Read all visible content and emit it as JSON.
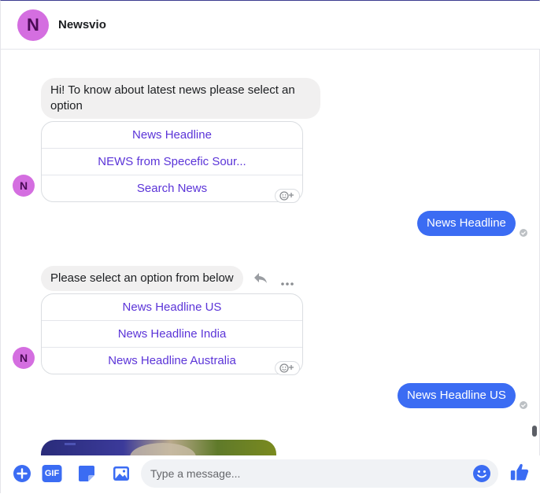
{
  "header": {
    "avatar_letter": "N",
    "title": "Newsvio"
  },
  "messages": {
    "greeting": {
      "text": "Hi! To know about latest news please select an option",
      "options": [
        "News Headline",
        "NEWS from Specefic Sour...",
        "Search News"
      ]
    },
    "user_reply_1": "News Headline",
    "prompt": {
      "text": "Please select an option from below",
      "options": [
        "News Headline US",
        "News Headline India",
        "News Headline Australia"
      ]
    },
    "user_reply_2": "News Headline US"
  },
  "composer": {
    "placeholder": "Type a message...",
    "gif_label": "GIF"
  },
  "icons": {
    "add": "plus-circle-icon",
    "gif": "gif-icon",
    "sticker": "sticker-icon",
    "image": "image-icon",
    "emoji": "emoji-icon",
    "like": "thumbs-up-icon",
    "react": "add-reaction-icon",
    "reply": "reply-icon",
    "more": "more-icon",
    "seen": "seen-check-icon"
  },
  "colors": {
    "accent": "#3b6cf3",
    "avatar": "#d46ee0",
    "option_text": "#5b34d8"
  }
}
